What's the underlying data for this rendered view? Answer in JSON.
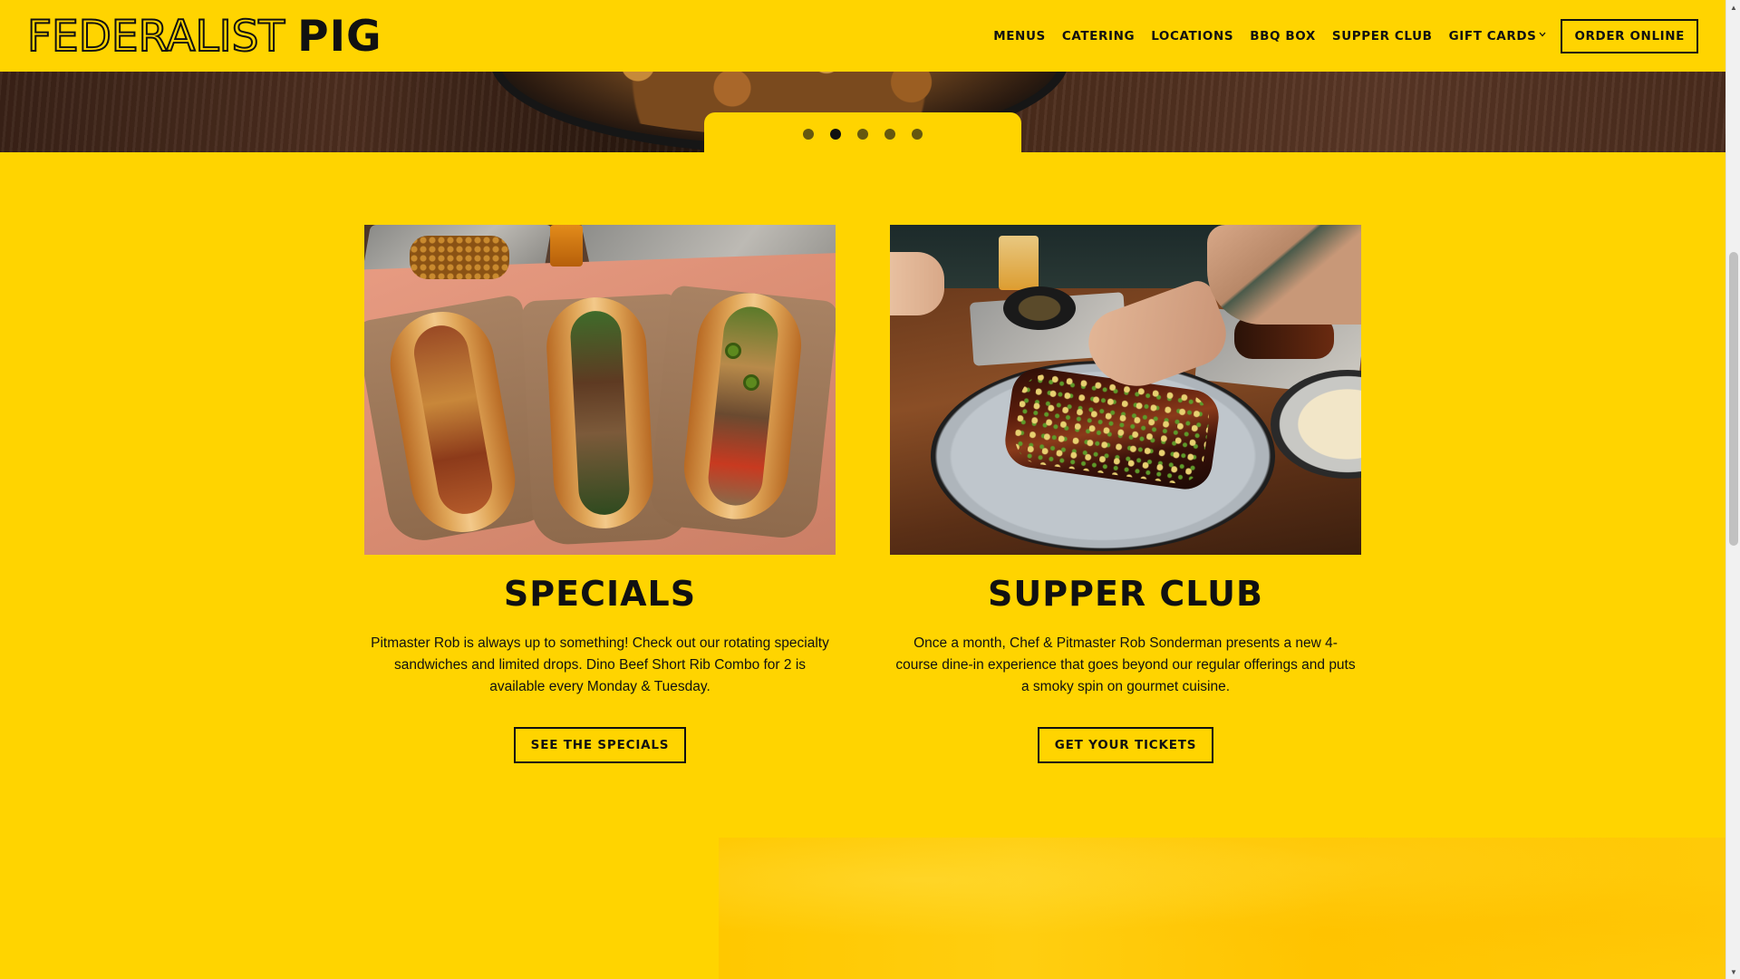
{
  "header": {
    "logo_outline": "FEDERALIST",
    "logo_solid": "PIG",
    "nav": [
      {
        "label": "MENUS"
      },
      {
        "label": "CATERING"
      },
      {
        "label": "LOCATIONS"
      },
      {
        "label": "BBQ BOX"
      },
      {
        "label": "SUPPER CLUB"
      },
      {
        "label": "GIFT CARDS",
        "has_dropdown": true
      }
    ],
    "order_button": "ORDER ONLINE"
  },
  "slider": {
    "slide_count": 5,
    "active_index": 1
  },
  "cards": {
    "specials": {
      "title": "SPECIALS",
      "body": "Pitmaster Rob is always up to something! Check out our rotating specialty sandwiches and limited drops. Dino Beef Short Rib Combo for 2 is available every Monday & Tuesday.",
      "button": "SEE THE SPECIALS"
    },
    "supper_club": {
      "title": "SUPPER CLUB",
      "body": "Once a month, Chef & Pitmaster Rob Sonderman presents a new 4-course dine-in experience that goes beyond our regular offerings and puts a smoky spin on gourmet cuisine.",
      "button": "GET YOUR TICKETS"
    }
  },
  "colors": {
    "brand_yellow": "#FFD400",
    "ink": "#111111"
  },
  "icons": {
    "dropdown": "chevron-down-icon",
    "scroll_up": "scroll-up-arrow-icon",
    "scroll_down": "scroll-down-arrow-icon"
  }
}
